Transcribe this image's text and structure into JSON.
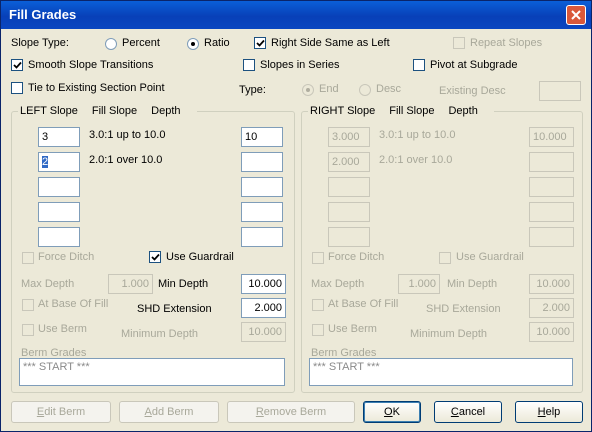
{
  "window": {
    "title": "Fill Grades"
  },
  "slope_type": {
    "label": "Slope Type:",
    "percent": "Percent",
    "ratio": "Ratio",
    "selected": "Ratio"
  },
  "options": {
    "right_same": "Right Side Same as Left",
    "repeat_slopes": "Repeat Slopes",
    "smooth": "Smooth Slope Transitions",
    "series": "Slopes in Series",
    "pivot": "Pivot at Subgrade",
    "tie": "Tie to Existing Section Point"
  },
  "type_row": {
    "label": "Type:",
    "end": "End",
    "desc": "Desc",
    "existing_desc": "Existing Desc",
    "existing_desc_value": ""
  },
  "left": {
    "title": "LEFT Slope",
    "col_fill": "Fill Slope",
    "col_depth": "Depth",
    "rows": [
      {
        "slope": "3",
        "desc": "3.0:1 up to 10.0",
        "depth": "10"
      },
      {
        "slope": "2",
        "desc": "2.0:1 over 10.0",
        "depth": ""
      },
      {
        "slope": "",
        "desc": "",
        "depth": ""
      },
      {
        "slope": "",
        "desc": "",
        "depth": ""
      },
      {
        "slope": "",
        "desc": "",
        "depth": ""
      }
    ],
    "force_ditch": "Force Ditch",
    "use_guardrail": "Use Guardrail",
    "max_depth_label": "Max Depth",
    "max_depth": "1.000",
    "min_depth_label": "Min Depth",
    "min_depth": "10.000",
    "at_base": "At Base Of Fill",
    "shd_label": "SHD Extension",
    "shd": "2.000",
    "use_berm": "Use Berm",
    "minimum_depth_label": "Minimum Depth",
    "minimum_depth": "10.000",
    "berm_label": "Berm Grades",
    "berm_value": "*** START ***"
  },
  "right": {
    "title": "RIGHT Slope",
    "col_fill": "Fill Slope",
    "col_depth": "Depth",
    "rows": [
      {
        "slope": "3.000",
        "desc": "3.0:1 up to 10.0",
        "depth": "10.000"
      },
      {
        "slope": "2.000",
        "desc": "2.0:1 over 10.0",
        "depth": ""
      },
      {
        "slope": "",
        "desc": "",
        "depth": ""
      },
      {
        "slope": "",
        "desc": "",
        "depth": ""
      },
      {
        "slope": "",
        "desc": "",
        "depth": ""
      }
    ],
    "force_ditch": "Force Ditch",
    "use_guardrail": "Use Guardrail",
    "max_depth_label": "Max Depth",
    "max_depth": "1.000",
    "min_depth_label": "Min Depth",
    "min_depth": "10.000",
    "at_base": "At Base Of Fill",
    "shd_label": "SHD Extension",
    "shd": "2.000",
    "use_berm": "Use Berm",
    "minimum_depth_label": "Minimum Depth",
    "minimum_depth": "10.000",
    "berm_label": "Berm Grades",
    "berm_value": "*** START ***"
  },
  "buttons": {
    "edit_berm": {
      "u": "E",
      "rest": "dit Berm"
    },
    "add_berm": {
      "u": "A",
      "rest": "dd Berm"
    },
    "remove_berm": {
      "u": "R",
      "rest": "emove Berm"
    },
    "ok": {
      "u": "O",
      "rest": "K"
    },
    "cancel": {
      "u": "C",
      "rest": "ancel"
    },
    "help": {
      "u": "H",
      "rest": "elp"
    }
  },
  "colors": {
    "title_bar": "#0a5fd8",
    "close": "#d9583a",
    "selection": "#316ac5",
    "face": "#ece9d8"
  }
}
